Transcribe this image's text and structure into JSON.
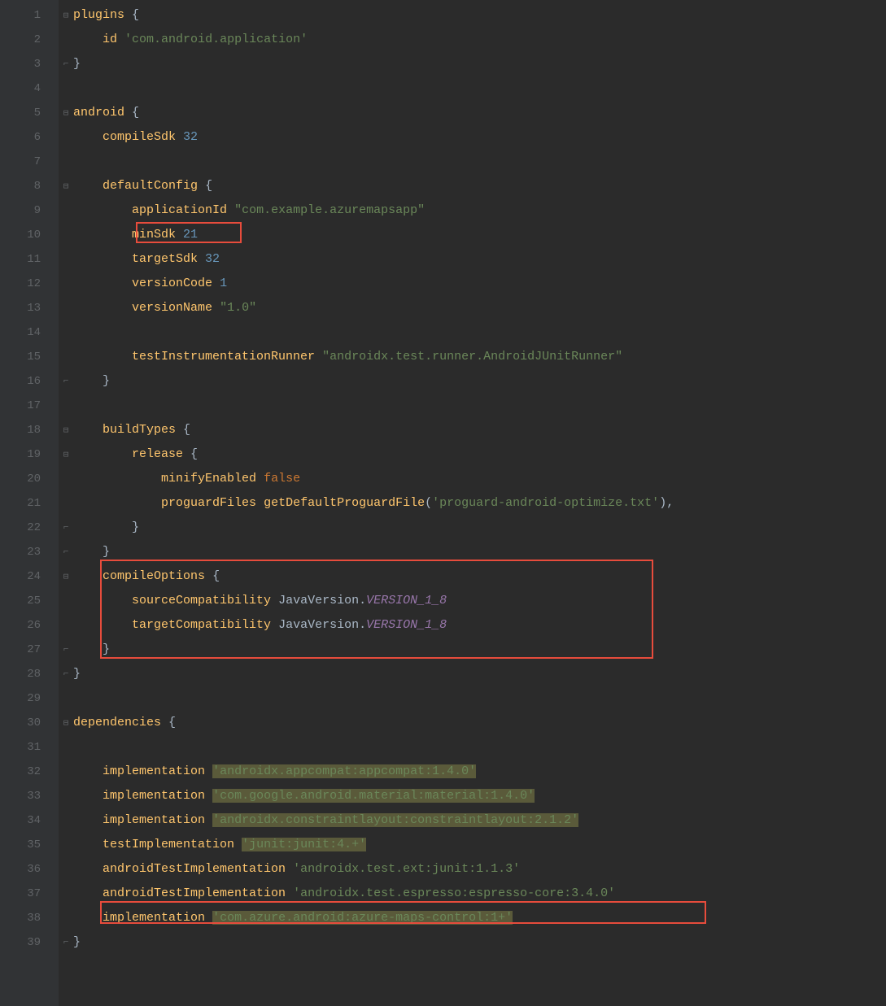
{
  "lines": [
    {
      "n": 1,
      "fold": "open",
      "segs": [
        [
          "fn",
          "plugins"
        ],
        [
          "plain",
          " "
        ],
        [
          "brace",
          "{"
        ]
      ]
    },
    {
      "n": 2,
      "fold": "",
      "segs": [
        [
          "plain",
          "    "
        ],
        [
          "fn",
          "id"
        ],
        [
          "plain",
          " "
        ],
        [
          "str",
          "'com.android.application'"
        ]
      ]
    },
    {
      "n": 3,
      "fold": "close",
      "segs": [
        [
          "brace",
          "}"
        ]
      ]
    },
    {
      "n": 4,
      "fold": "",
      "segs": []
    },
    {
      "n": 5,
      "fold": "open",
      "segs": [
        [
          "fn",
          "android"
        ],
        [
          "plain",
          " "
        ],
        [
          "brace",
          "{"
        ]
      ]
    },
    {
      "n": 6,
      "fold": "",
      "segs": [
        [
          "plain",
          "    "
        ],
        [
          "fn",
          "compileSdk"
        ],
        [
          "plain",
          " "
        ],
        [
          "num",
          "32"
        ]
      ]
    },
    {
      "n": 7,
      "fold": "",
      "segs": []
    },
    {
      "n": 8,
      "fold": "open",
      "segs": [
        [
          "plain",
          "    "
        ],
        [
          "fn",
          "defaultConfig"
        ],
        [
          "plain",
          " "
        ],
        [
          "brace",
          "{"
        ]
      ]
    },
    {
      "n": 9,
      "fold": "",
      "segs": [
        [
          "plain",
          "        "
        ],
        [
          "fn",
          "applicationId"
        ],
        [
          "plain",
          " "
        ],
        [
          "str",
          "\"com.example.azuremapsapp\""
        ]
      ]
    },
    {
      "n": 10,
      "fold": "",
      "segs": [
        [
          "plain",
          "        "
        ],
        [
          "fn",
          "minSdk"
        ],
        [
          "plain",
          " "
        ],
        [
          "num",
          "21"
        ]
      ]
    },
    {
      "n": 11,
      "fold": "",
      "segs": [
        [
          "plain",
          "        "
        ],
        [
          "fn",
          "targetSdk"
        ],
        [
          "plain",
          " "
        ],
        [
          "num",
          "32"
        ]
      ]
    },
    {
      "n": 12,
      "fold": "",
      "segs": [
        [
          "plain",
          "        "
        ],
        [
          "fn",
          "versionCode"
        ],
        [
          "plain",
          " "
        ],
        [
          "num",
          "1"
        ]
      ]
    },
    {
      "n": 13,
      "fold": "",
      "segs": [
        [
          "plain",
          "        "
        ],
        [
          "fn",
          "versionName"
        ],
        [
          "plain",
          " "
        ],
        [
          "str",
          "\"1.0\""
        ]
      ]
    },
    {
      "n": 14,
      "fold": "",
      "segs": []
    },
    {
      "n": 15,
      "fold": "",
      "segs": [
        [
          "plain",
          "        "
        ],
        [
          "fn",
          "testInstrumentationRunner"
        ],
        [
          "plain",
          " "
        ],
        [
          "str",
          "\"androidx.test.runner.AndroidJUnitRunner\""
        ]
      ]
    },
    {
      "n": 16,
      "fold": "close",
      "segs": [
        [
          "plain",
          "    "
        ],
        [
          "brace",
          "}"
        ]
      ]
    },
    {
      "n": 17,
      "fold": "",
      "segs": []
    },
    {
      "n": 18,
      "fold": "open",
      "segs": [
        [
          "plain",
          "    "
        ],
        [
          "fn",
          "buildTypes"
        ],
        [
          "plain",
          " "
        ],
        [
          "brace",
          "{"
        ]
      ]
    },
    {
      "n": 19,
      "fold": "open",
      "segs": [
        [
          "plain",
          "        "
        ],
        [
          "fn",
          "release"
        ],
        [
          "plain",
          " "
        ],
        [
          "brace",
          "{"
        ]
      ]
    },
    {
      "n": 20,
      "fold": "",
      "segs": [
        [
          "plain",
          "            "
        ],
        [
          "fn",
          "minifyEnabled"
        ],
        [
          "plain",
          " "
        ],
        [
          "const",
          "false"
        ]
      ]
    },
    {
      "n": 21,
      "fold": "",
      "segs": [
        [
          "plain",
          "            "
        ],
        [
          "fn",
          "proguardFiles"
        ],
        [
          "plain",
          " "
        ],
        [
          "fn",
          "getDefaultProguardFile"
        ],
        [
          "punct",
          "("
        ],
        [
          "str",
          "'proguard-android-optimize.txt'"
        ],
        [
          "punct",
          ")"
        ],
        [
          "punct",
          ","
        ]
      ]
    },
    {
      "n": 22,
      "fold": "close",
      "segs": [
        [
          "plain",
          "        "
        ],
        [
          "brace",
          "}"
        ]
      ]
    },
    {
      "n": 23,
      "fold": "close",
      "segs": [
        [
          "plain",
          "    "
        ],
        [
          "brace",
          "}"
        ]
      ]
    },
    {
      "n": 24,
      "fold": "open",
      "segs": [
        [
          "plain",
          "    "
        ],
        [
          "fn",
          "compileOptions"
        ],
        [
          "plain",
          " "
        ],
        [
          "brace",
          "{"
        ]
      ]
    },
    {
      "n": 25,
      "fold": "",
      "segs": [
        [
          "plain",
          "        "
        ],
        [
          "fn",
          "sourceCompatibility"
        ],
        [
          "plain",
          " "
        ],
        [
          "plain",
          "JavaVersion"
        ],
        [
          "punct",
          "."
        ],
        [
          "static",
          "VERSION_1_8"
        ]
      ]
    },
    {
      "n": 26,
      "fold": "",
      "segs": [
        [
          "plain",
          "        "
        ],
        [
          "fn",
          "targetCompatibility"
        ],
        [
          "plain",
          " "
        ],
        [
          "plain",
          "JavaVersion"
        ],
        [
          "punct",
          "."
        ],
        [
          "static",
          "VERSION_1_8"
        ]
      ]
    },
    {
      "n": 27,
      "fold": "close",
      "segs": [
        [
          "plain",
          "    "
        ],
        [
          "brace",
          "}"
        ]
      ]
    },
    {
      "n": 28,
      "fold": "close",
      "segs": [
        [
          "brace",
          "}"
        ]
      ]
    },
    {
      "n": 29,
      "fold": "",
      "segs": []
    },
    {
      "n": 30,
      "fold": "open",
      "segs": [
        [
          "fn",
          "dependencies"
        ],
        [
          "plain",
          " "
        ],
        [
          "brace",
          "{"
        ]
      ]
    },
    {
      "n": 31,
      "fold": "",
      "segs": []
    },
    {
      "n": 32,
      "fold": "",
      "segs": [
        [
          "plain",
          "    "
        ],
        [
          "fn",
          "implementation"
        ],
        [
          "plain",
          " "
        ],
        [
          "str-hl",
          "'androidx.appcompat:appcompat:1.4.0'"
        ]
      ]
    },
    {
      "n": 33,
      "fold": "",
      "segs": [
        [
          "plain",
          "    "
        ],
        [
          "fn",
          "implementation"
        ],
        [
          "plain",
          " "
        ],
        [
          "str-hl",
          "'com.google.android.material:material:1.4.0'"
        ]
      ]
    },
    {
      "n": 34,
      "fold": "",
      "segs": [
        [
          "plain",
          "    "
        ],
        [
          "fn",
          "implementation"
        ],
        [
          "plain",
          " "
        ],
        [
          "str-hl",
          "'androidx.constraintlayout:constraintlayout:2.1.2'"
        ]
      ]
    },
    {
      "n": 35,
      "fold": "",
      "segs": [
        [
          "plain",
          "    "
        ],
        [
          "fn",
          "testImplementation"
        ],
        [
          "plain",
          " "
        ],
        [
          "str-hl",
          "'junit:junit:4.+'"
        ]
      ]
    },
    {
      "n": 36,
      "fold": "",
      "segs": [
        [
          "plain",
          "    "
        ],
        [
          "fn",
          "androidTestImplementation"
        ],
        [
          "plain",
          " "
        ],
        [
          "str",
          "'androidx.test.ext:junit:1.1.3'"
        ]
      ]
    },
    {
      "n": 37,
      "fold": "",
      "segs": [
        [
          "plain",
          "    "
        ],
        [
          "fn",
          "androidTestImplementation"
        ],
        [
          "plain",
          " "
        ],
        [
          "str",
          "'androidx.test.espresso:espresso-core:3.4.0'"
        ]
      ]
    },
    {
      "n": 38,
      "fold": "",
      "segs": [
        [
          "plain",
          "    "
        ],
        [
          "fn",
          "implementation"
        ],
        [
          "plain",
          " "
        ],
        [
          "str-hl",
          "'com.azure.android:azure-maps-control:1+'"
        ]
      ]
    },
    {
      "n": 39,
      "fold": "close",
      "segs": [
        [
          "brace",
          "}"
        ]
      ]
    }
  ],
  "highlights": {
    "minSdk": "minSdk 21",
    "compileOptions": "compileOptions block",
    "azureMaps": "implementation 'com.azure.android:azure-maps-control:1+'"
  }
}
